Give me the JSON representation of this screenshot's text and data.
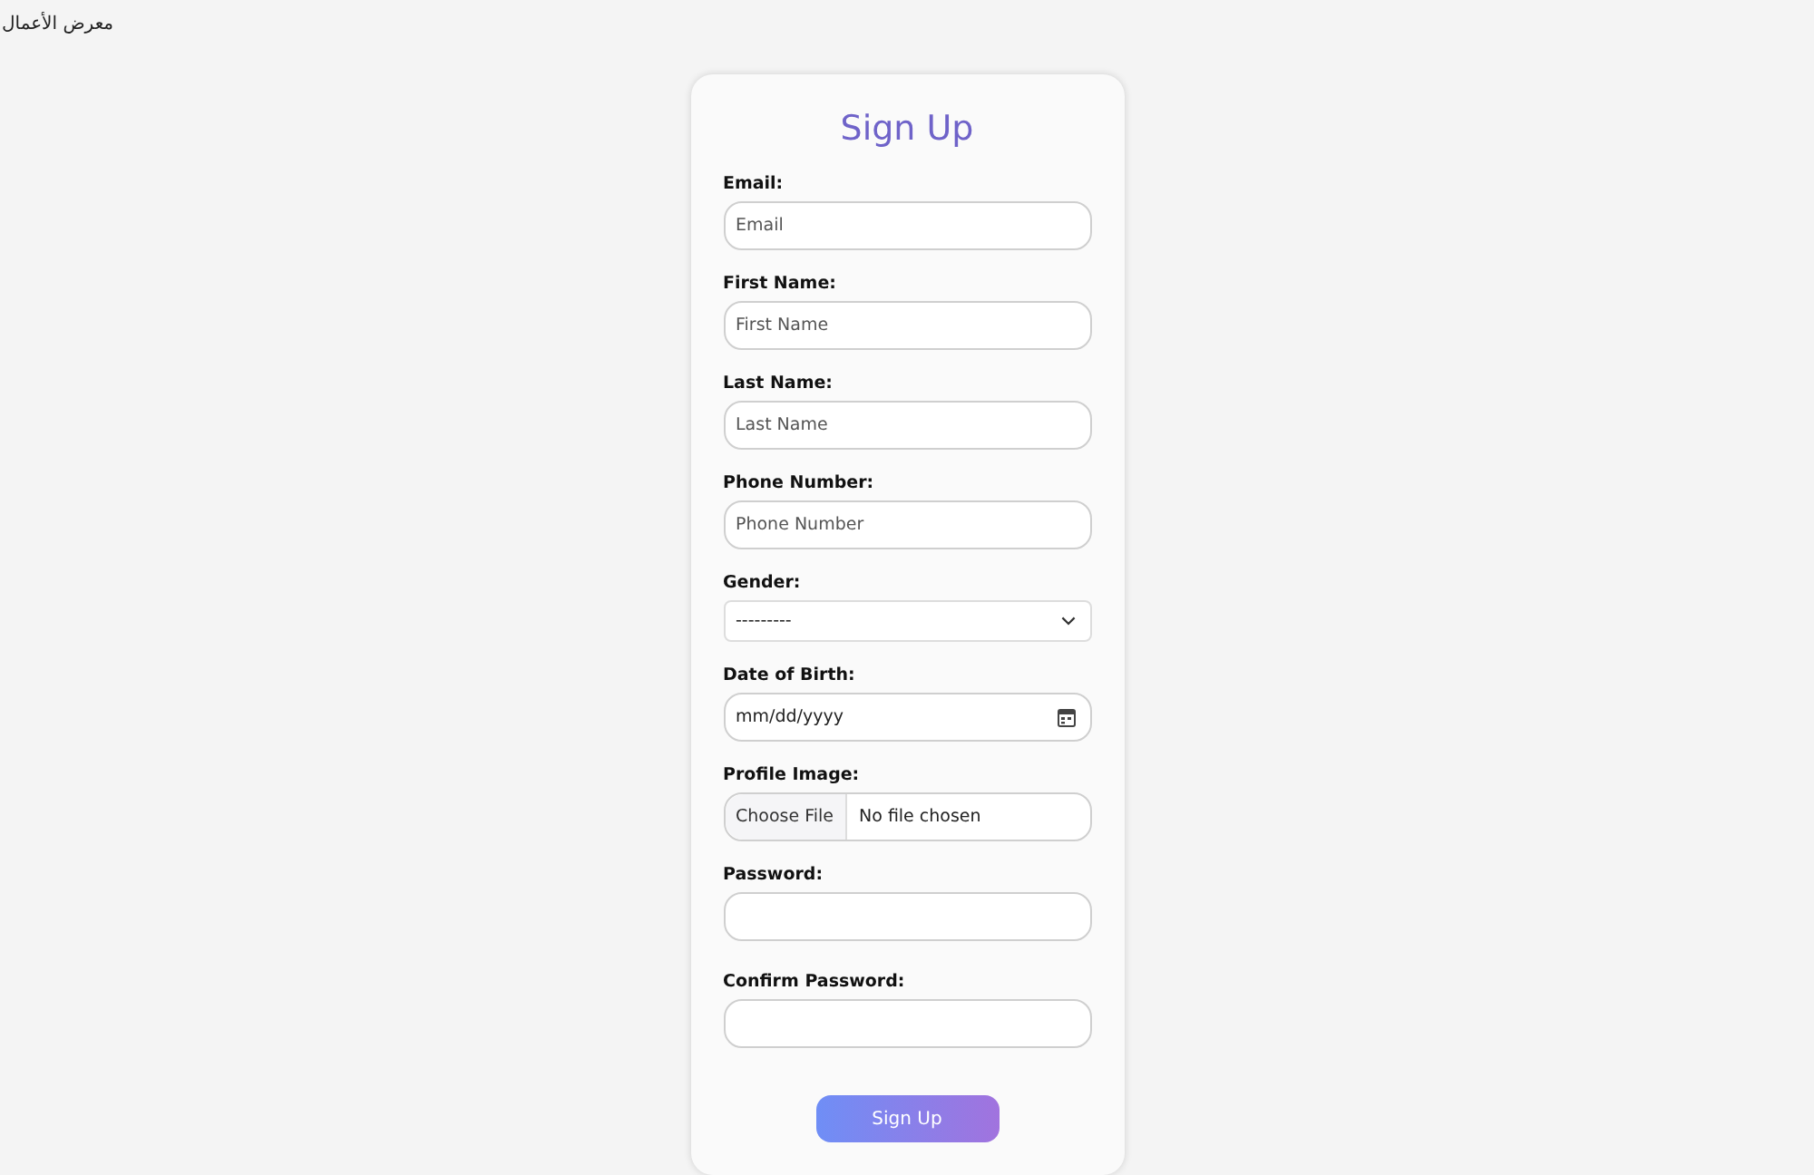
{
  "page_heading": "معرض الأعمال",
  "form": {
    "title": "Sign Up",
    "fields": [
      {
        "kind": "text",
        "label": "Email:",
        "placeholder": "Email"
      },
      {
        "kind": "text",
        "label": "First Name:",
        "placeholder": "First Name"
      },
      {
        "kind": "text",
        "label": "Last Name:",
        "placeholder": "Last Name"
      },
      {
        "kind": "text",
        "label": "Phone Number:",
        "placeholder": "Phone Number"
      },
      {
        "kind": "select",
        "label": "Gender:",
        "value": "---------"
      },
      {
        "kind": "date",
        "label": "Date of Birth:",
        "placeholder": "mm/dd/yyyy"
      },
      {
        "kind": "file",
        "label": "Profile Image:",
        "button": "Choose File",
        "status": "No file chosen"
      },
      {
        "kind": "password",
        "label": "Password:"
      },
      {
        "kind": "password",
        "label": "Confirm Password:"
      }
    ],
    "submit": "Sign Up"
  }
}
